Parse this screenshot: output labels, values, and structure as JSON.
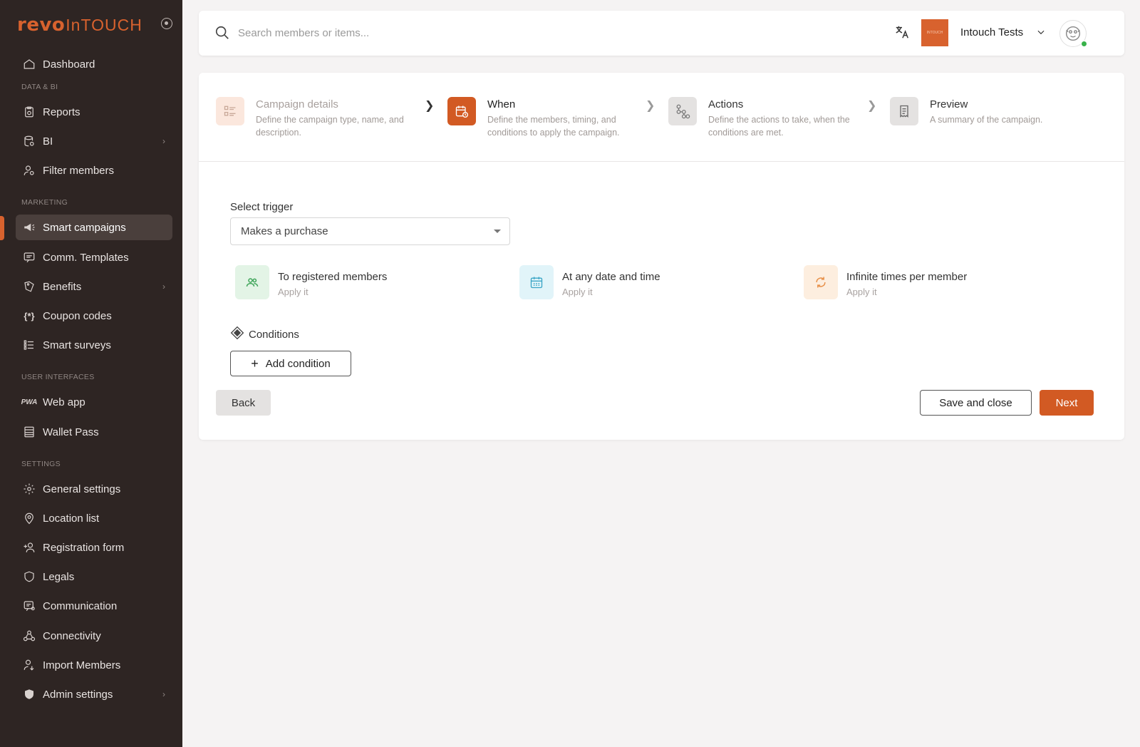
{
  "brand": {
    "logo_word": "revo",
    "logo_suffix": "InTOUCH",
    "accent_color": "#d8622e"
  },
  "sidebar": {
    "items": [
      {
        "label": "Dashboard"
      },
      {
        "section": "DATA & BI"
      },
      {
        "label": "Reports"
      },
      {
        "label": "BI"
      },
      {
        "label": "Filter members"
      },
      {
        "section": "MARKETING"
      },
      {
        "label": "Smart campaigns",
        "active": true
      },
      {
        "label": "Comm. Templates"
      },
      {
        "label": "Benefits"
      },
      {
        "label": "Coupon codes"
      },
      {
        "label": "Smart surveys"
      },
      {
        "section": "USER INTERFACES"
      },
      {
        "label": "Web app"
      },
      {
        "label": "Wallet Pass"
      },
      {
        "section": "SETTINGS"
      },
      {
        "label": "General settings"
      },
      {
        "label": "Location list"
      },
      {
        "label": "Registration form"
      },
      {
        "label": "Legals"
      },
      {
        "label": "Communication"
      },
      {
        "label": "Connectivity"
      },
      {
        "label": "Import Members"
      },
      {
        "label": "Admin settings"
      }
    ]
  },
  "topbar": {
    "search_placeholder": "Search members or items...",
    "account_name": "Intouch Tests",
    "brand_logo_text": "INTOUCH"
  },
  "steps": [
    {
      "title": "Campaign details",
      "desc": "Define the campaign type, name, and description.",
      "state": "done"
    },
    {
      "title": "When",
      "desc": "Define the members, timing, and conditions to apply the campaign.",
      "state": "current"
    },
    {
      "title": "Actions",
      "desc": "Define the actions to take, when the conditions are met.",
      "state": "pending"
    },
    {
      "title": "Preview",
      "desc": "A summary of the campaign.",
      "state": "pending"
    }
  ],
  "form": {
    "trigger_label": "Select trigger",
    "trigger_value": "Makes a purchase",
    "options": [
      {
        "title": "To registered members",
        "sub": "Apply it"
      },
      {
        "title": "At any date and time",
        "sub": "Apply it"
      },
      {
        "title": "Infinite times per member",
        "sub": "Apply it"
      }
    ],
    "conditions_label": "Conditions",
    "add_condition_label": "Add condition"
  },
  "footer": {
    "back_label": "Back",
    "save_label": "Save and close",
    "next_label": "Next"
  }
}
